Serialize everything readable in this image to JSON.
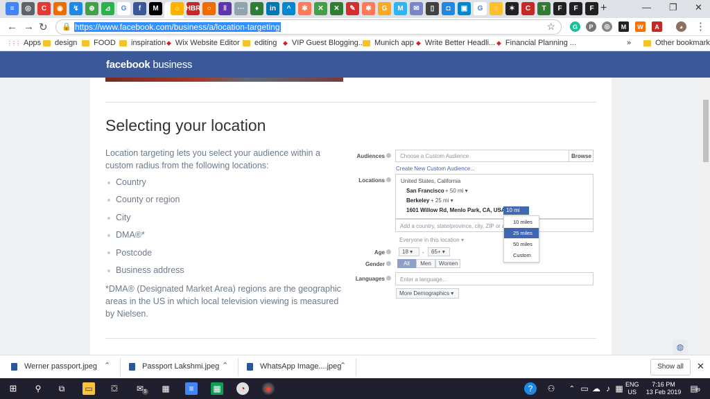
{
  "browser": {
    "tabs": [
      {
        "icon": "docs-icon",
        "color": "#4285f4",
        "glyph": "≡"
      },
      {
        "icon": "chrome-icon",
        "color": "#5f6368",
        "glyph": "◎"
      },
      {
        "icon": "c-icon",
        "color": "#e53935",
        "glyph": "C"
      },
      {
        "icon": "orange-icon",
        "color": "#ef6c00",
        "glyph": "◉"
      },
      {
        "icon": "blue-arrow-icon",
        "color": "#1e88e5",
        "glyph": "↯"
      },
      {
        "icon": "green-icon",
        "color": "#43a047",
        "glyph": "⊕"
      },
      {
        "icon": "feedly-icon",
        "color": "#2bb24c",
        "glyph": "⊿"
      },
      {
        "icon": "google-icon",
        "color": "#ffffff",
        "glyph": "G"
      },
      {
        "icon": "facebook-icon",
        "color": "#3b5998",
        "glyph": "f"
      },
      {
        "icon": "medium-icon",
        "color": "#000000",
        "glyph": "M"
      },
      {
        "icon": "sun-icon",
        "color": "#ffb300",
        "glyph": "☼"
      },
      {
        "icon": "hbr-icon",
        "color": "#c62828",
        "glyph": "HBR"
      },
      {
        "icon": "circle-icon",
        "color": "#ef6c00",
        "glyph": "○"
      },
      {
        "icon": "bars-icon",
        "color": "#5e35b1",
        "glyph": "‖"
      },
      {
        "icon": "dots-icon",
        "color": "#90a4ae",
        "glyph": "⋯"
      },
      {
        "icon": "map-pin-icon",
        "color": "#2e7d32",
        "glyph": "♦"
      },
      {
        "icon": "linkedin-icon",
        "color": "#0077b5",
        "glyph": "in"
      },
      {
        "icon": "caret-icon",
        "color": "#0288d1",
        "glyph": "^"
      },
      {
        "icon": "hubspot-icon",
        "color": "#ff7a59",
        "glyph": "✱"
      },
      {
        "icon": "x-green-icon",
        "color": "#43a047",
        "glyph": "✕"
      },
      {
        "icon": "x-green-icon-2",
        "color": "#2e7d32",
        "glyph": "✕"
      },
      {
        "icon": "red-circle-icon",
        "color": "#d32f2f",
        "glyph": "✎"
      },
      {
        "icon": "hubspot-icon-2",
        "color": "#ff7a59",
        "glyph": "✱"
      },
      {
        "icon": "grammarly-icon",
        "color": "#f9a825",
        "glyph": "G"
      },
      {
        "icon": "m-blue-icon",
        "color": "#29b6f6",
        "glyph": "M"
      },
      {
        "icon": "mail-icon",
        "color": "#7986cb",
        "glyph": "✉"
      },
      {
        "icon": "pages-icon",
        "color": "#424242",
        "glyph": "▯"
      },
      {
        "icon": "blue-square-icon",
        "color": "#1e88e5",
        "glyph": "◘"
      },
      {
        "icon": "frame-icon",
        "color": "#0288d1",
        "glyph": "▣"
      },
      {
        "icon": "google-icon-2",
        "color": "#ffffff",
        "glyph": "G"
      },
      {
        "icon": "ring-icon",
        "color": "#fbc02d",
        "glyph": "◌"
      },
      {
        "icon": "spider-icon",
        "color": "#212121",
        "glyph": "✶"
      },
      {
        "icon": "c-red-icon",
        "color": "#c62828",
        "glyph": "C"
      },
      {
        "icon": "t-green-icon",
        "color": "#2e7d32",
        "glyph": "T"
      },
      {
        "icon": "f-icon",
        "color": "#212121",
        "glyph": "F"
      },
      {
        "icon": "f-icon-2",
        "color": "#212121",
        "glyph": "F"
      },
      {
        "icon": "f-icon-3",
        "color": "#212121",
        "glyph": "F"
      }
    ],
    "url": "https://www.facebook.com/business/a/location-targeting",
    "bookmarks": [
      {
        "label": "Apps",
        "type": "apps"
      },
      {
        "label": "design",
        "type": "folder"
      },
      {
        "label": "FOOD",
        "type": "folder"
      },
      {
        "label": "inspiration",
        "type": "folder"
      },
      {
        "label": "Wix Website Editor",
        "type": "site"
      },
      {
        "label": "editing",
        "type": "folder"
      },
      {
        "label": "VIP Guest Blogging...",
        "type": "site"
      },
      {
        "label": "Munich app",
        "type": "folder"
      },
      {
        "label": "Write Better Headli...",
        "type": "site"
      },
      {
        "label": "Financial Planning ...",
        "type": "site"
      }
    ],
    "other_bookmarks": "Other bookmarks",
    "overflow": "»"
  },
  "page": {
    "brand_bold": "facebook",
    "brand_light": " business",
    "heading": "Selecting your location",
    "intro": "Location targeting lets you select your audience within a custom radius from the following locations:",
    "locations": [
      "Country",
      "County or region",
      "City",
      "DMA®*",
      "Postcode",
      "Business address"
    ],
    "footnote": "*DMA® (Designated Market Area) regions are the geographic areas in the US in which local television viewing is measured by Nielsen."
  },
  "form": {
    "audiences_label": "Audiences",
    "audiences_placeholder": "Choose a Custom Audience",
    "browse": "Browse",
    "create_link": "Create New Custom Audience...",
    "locations_label": "Locations",
    "loc_country": "United States, California",
    "loc1_name": "San Francisco",
    "loc1_radius": "+ 50 mi ▾",
    "loc2_name": "Berkeley",
    "loc2_radius": "+ 25 mi ▾",
    "loc3_name": "1601 Willow Rd, Menlo Park, CA, USA",
    "loc3_plus": "+",
    "loc3_radius": "10 mi",
    "loc_placeholder": "Add a country, state/province, city, ZIP or add",
    "everyone": "Everyone in this location ▾",
    "radius_options": [
      "10 miles",
      "25 miles",
      "50 miles",
      "Custom"
    ],
    "radius_highlight": "25 miles",
    "age_label": "Age",
    "age_min": "18 ▾",
    "age_dash": "-",
    "age_max": "65+ ▾",
    "gender_label": "Gender",
    "gender_options": [
      "All",
      "Men",
      "Women"
    ],
    "gender_selected": "All",
    "languages_label": "Languages",
    "languages_placeholder": "Enter a language...",
    "more_demo": "More Demographics ▾"
  },
  "downloads": [
    {
      "name": "Werner passport.jpeg"
    },
    {
      "name": "Passport Lakshmi.jpeg"
    },
    {
      "name": "WhatsApp Image....jpeg"
    }
  ],
  "show_all": "Show all",
  "taskbar": {
    "lang": "ENG",
    "region": "US",
    "time": "7:16 PM",
    "date": "13 Feb 2019",
    "notif_count": "19",
    "mail_badge": "5"
  }
}
